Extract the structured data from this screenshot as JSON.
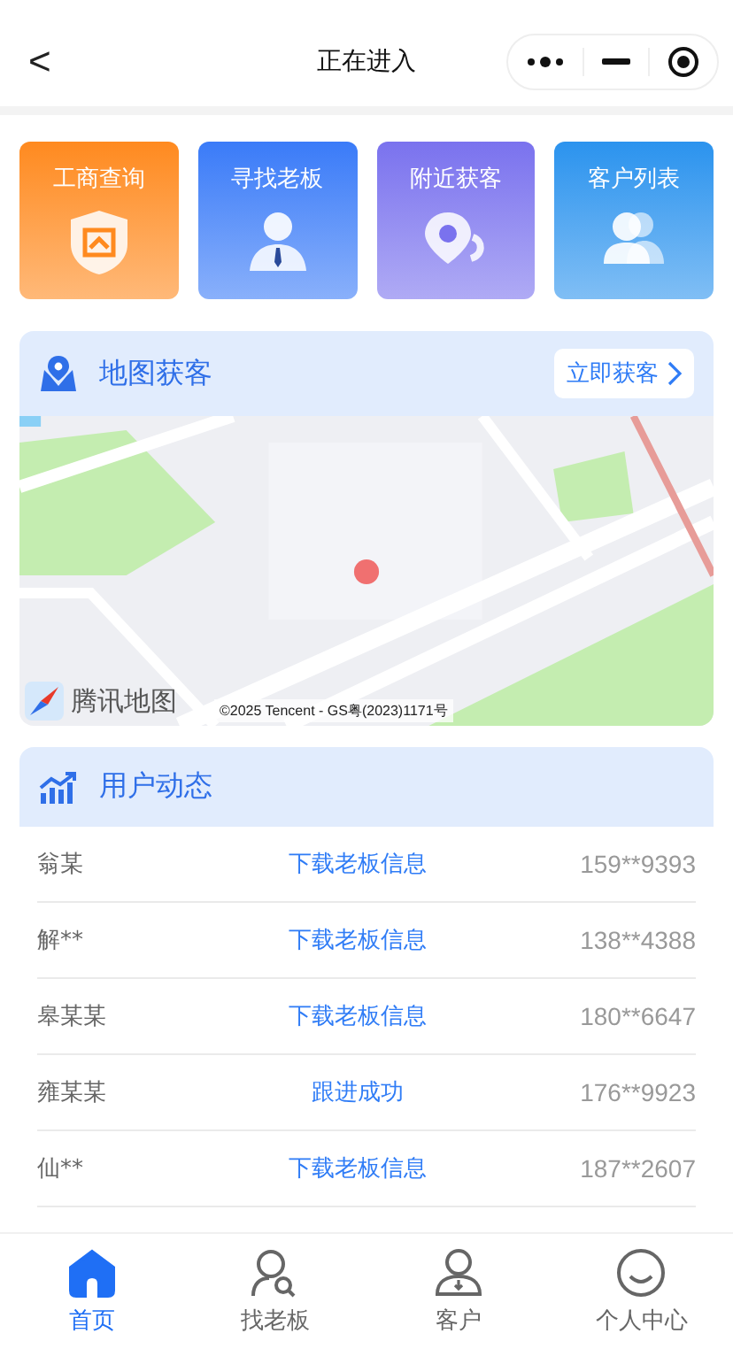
{
  "nav": {
    "back": "<",
    "title": "正在进入"
  },
  "features": [
    {
      "label": "工商查询",
      "kind": "shield",
      "color": "#ff8a1f"
    },
    {
      "label": "寻找老板",
      "kind": "boss",
      "color": "#3a7bf8"
    },
    {
      "label": "附近获客",
      "kind": "pin",
      "color": "#7a72ee"
    },
    {
      "label": "客户列表",
      "kind": "people",
      "color": "#2b93ee"
    }
  ],
  "map_section": {
    "title": "地图获客",
    "action": "立即获客",
    "logo": "腾讯地图",
    "copyright": "©2025 Tencent - GS粤(2023)1171号"
  },
  "activity": {
    "title": "用户动态",
    "rows": [
      {
        "name": "翁某",
        "action": "下载老板信息",
        "phone": "159**9393"
      },
      {
        "name": "解**",
        "action": "下载老板信息",
        "phone": "138**4388"
      },
      {
        "name": "皋某某",
        "action": "下载老板信息",
        "phone": "180**6647"
      },
      {
        "name": "雍某某",
        "action": "跟进成功",
        "phone": "176**9923"
      },
      {
        "name": "仙**",
        "action": "下载老板信息",
        "phone": "187**2607"
      }
    ]
  },
  "tabbar": [
    {
      "label": "首页",
      "kind": "home",
      "selected": true
    },
    {
      "label": "找老板",
      "kind": "search-person",
      "selected": false
    },
    {
      "label": "客户",
      "kind": "person",
      "selected": false
    },
    {
      "label": "个人中心",
      "kind": "face",
      "selected": false
    }
  ]
}
